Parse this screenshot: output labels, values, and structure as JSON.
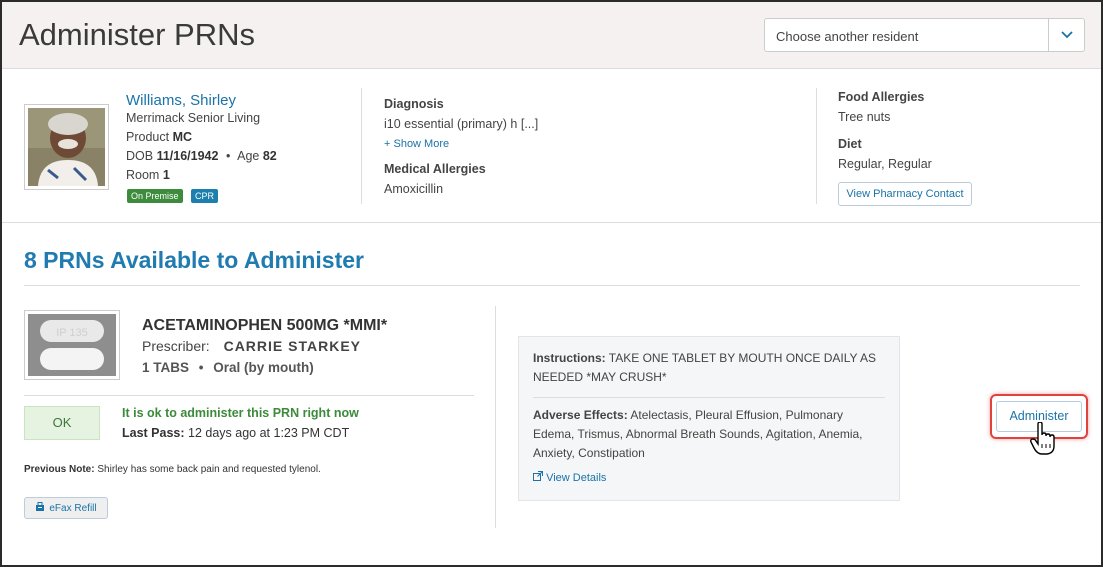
{
  "header": {
    "title": "Administer PRNs",
    "resident_select": {
      "placeholder": "Choose another resident"
    }
  },
  "resident": {
    "name": "Williams, Shirley",
    "facility": "Merrimack Senior Living",
    "product_label": "Product",
    "product_value": "MC",
    "dob_label": "DOB",
    "dob_value": "11/16/1942",
    "age_label": "Age",
    "age_value": "82",
    "room_label": "Room",
    "room_value": "1",
    "badges": [
      "On Premise",
      "CPR"
    ]
  },
  "clinical": {
    "diagnosis_label": "Diagnosis",
    "diagnosis_value": "i10 essential (primary) h [...]",
    "show_more": "Show More",
    "med_allergies_label": "Medical Allergies",
    "med_allergies_value": "Amoxicillin",
    "food_allergies_label": "Food Allergies",
    "food_allergies_value": "Tree nuts",
    "diet_label": "Diet",
    "diet_value": "Regular, Regular",
    "pharmacy_button": "View Pharmacy Contact"
  },
  "prn": {
    "section_title": "8 PRNs Available to Administer",
    "pill_imprint": "IP 135",
    "drug_name": "ACETAMINOPHEN 500MG *MMI*",
    "prescriber_label": "Prescriber:",
    "prescriber_name": "CARRIE STARKEY",
    "dose": "1 TABS",
    "route": "Oral (by mouth)",
    "status": "OK",
    "status_message": "It is ok to administer this PRN right now",
    "last_pass_label": "Last Pass:",
    "last_pass_value": "12 days ago at 1:23 PM CDT",
    "previous_note_label": "Previous Note:",
    "previous_note_value": "Shirley has some back pain and requested tylenol.",
    "efax_button": "eFax Refill",
    "instructions_label": "Instructions:",
    "instructions_value": "TAKE ONE TABLET BY MOUTH ONCE DAILY AS NEEDED *MAY CRUSH*",
    "adverse_label": "Adverse Effects:",
    "adverse_value": "Atelectasis, Pleural Effusion, Pulmonary Edema, Trismus, Abnormal Breath Sounds, Agitation, Anemia, Anxiety, Constipation",
    "view_details": "View Details",
    "administer_button": "Administer"
  },
  "colors": {
    "link": "#1a73a8",
    "ok_green": "#3c8a3c",
    "highlight_red": "#e0433f",
    "header_bg": "#f5f1f0"
  }
}
